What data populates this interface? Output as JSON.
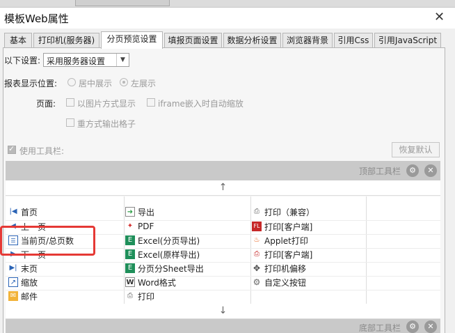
{
  "dialog": {
    "title": "模板Web属性",
    "close": "✕"
  },
  "tabs": [
    "基本",
    "打印机(服务器)",
    "分页预览设置",
    "填报页面设置",
    "数据分析设置",
    "浏览器背景",
    "引用Css",
    "引用JavaScript"
  ],
  "settings": {
    "mode_label": "以下设置:",
    "mode_value": "采用服务器设置",
    "position_label": "报表显示位置:",
    "center_label": "居中展示",
    "left_label": "左展示",
    "page_label": "页面:",
    "image_label": "以图片方式显示",
    "iframe_label": "iframe嵌入时自动缩放",
    "reformat_label": "重方式输出格子",
    "toolbar_label": "使用工具栏:",
    "reset_label": "恢复默认"
  },
  "toolbars": {
    "top_label": "顶部工具栏",
    "bottom_label": "底部工具栏",
    "gear": "⚙",
    "remove": "✕",
    "up": "↑",
    "down": "↓"
  },
  "buttons": {
    "col1": [
      {
        "icon": "first-page-icon",
        "label": "首页"
      },
      {
        "icon": "prev-page-icon",
        "label": "上一页"
      },
      {
        "icon": "page-count-icon",
        "label": "当前页/总页数"
      },
      {
        "icon": "next-page-icon",
        "label": "下一页"
      },
      {
        "icon": "last-page-icon",
        "label": "末页"
      },
      {
        "icon": "zoom-icon",
        "label": "缩放"
      },
      {
        "icon": "mail-icon",
        "label": "邮件"
      }
    ],
    "col2": [
      {
        "icon": "export-icon",
        "label": "导出"
      },
      {
        "icon": "pdf-icon",
        "label": "PDF"
      },
      {
        "icon": "excel-icon",
        "label": "Excel(分页导出)"
      },
      {
        "icon": "excel-icon",
        "label": "Excel(原样导出)"
      },
      {
        "icon": "excel-sheet-icon",
        "label": "分页分Sheet导出"
      },
      {
        "icon": "word-icon",
        "label": "Word格式"
      },
      {
        "icon": "print-icon",
        "label": "打印"
      }
    ],
    "col3": [
      {
        "icon": "printer-icon",
        "label": "打印（兼容）"
      },
      {
        "icon": "flash-print-icon",
        "label": "打印[客户端]"
      },
      {
        "icon": "java-icon",
        "label": "Applet打印"
      },
      {
        "icon": "client-print-icon",
        "label": "打印[客户端]"
      },
      {
        "icon": "move-icon",
        "label": "打印机偏移"
      },
      {
        "icon": "gear-icon",
        "label": "自定义按钮"
      }
    ]
  },
  "colors": {
    "highlight": "#e53935",
    "toolbar_bg": "#c9c9c9"
  }
}
